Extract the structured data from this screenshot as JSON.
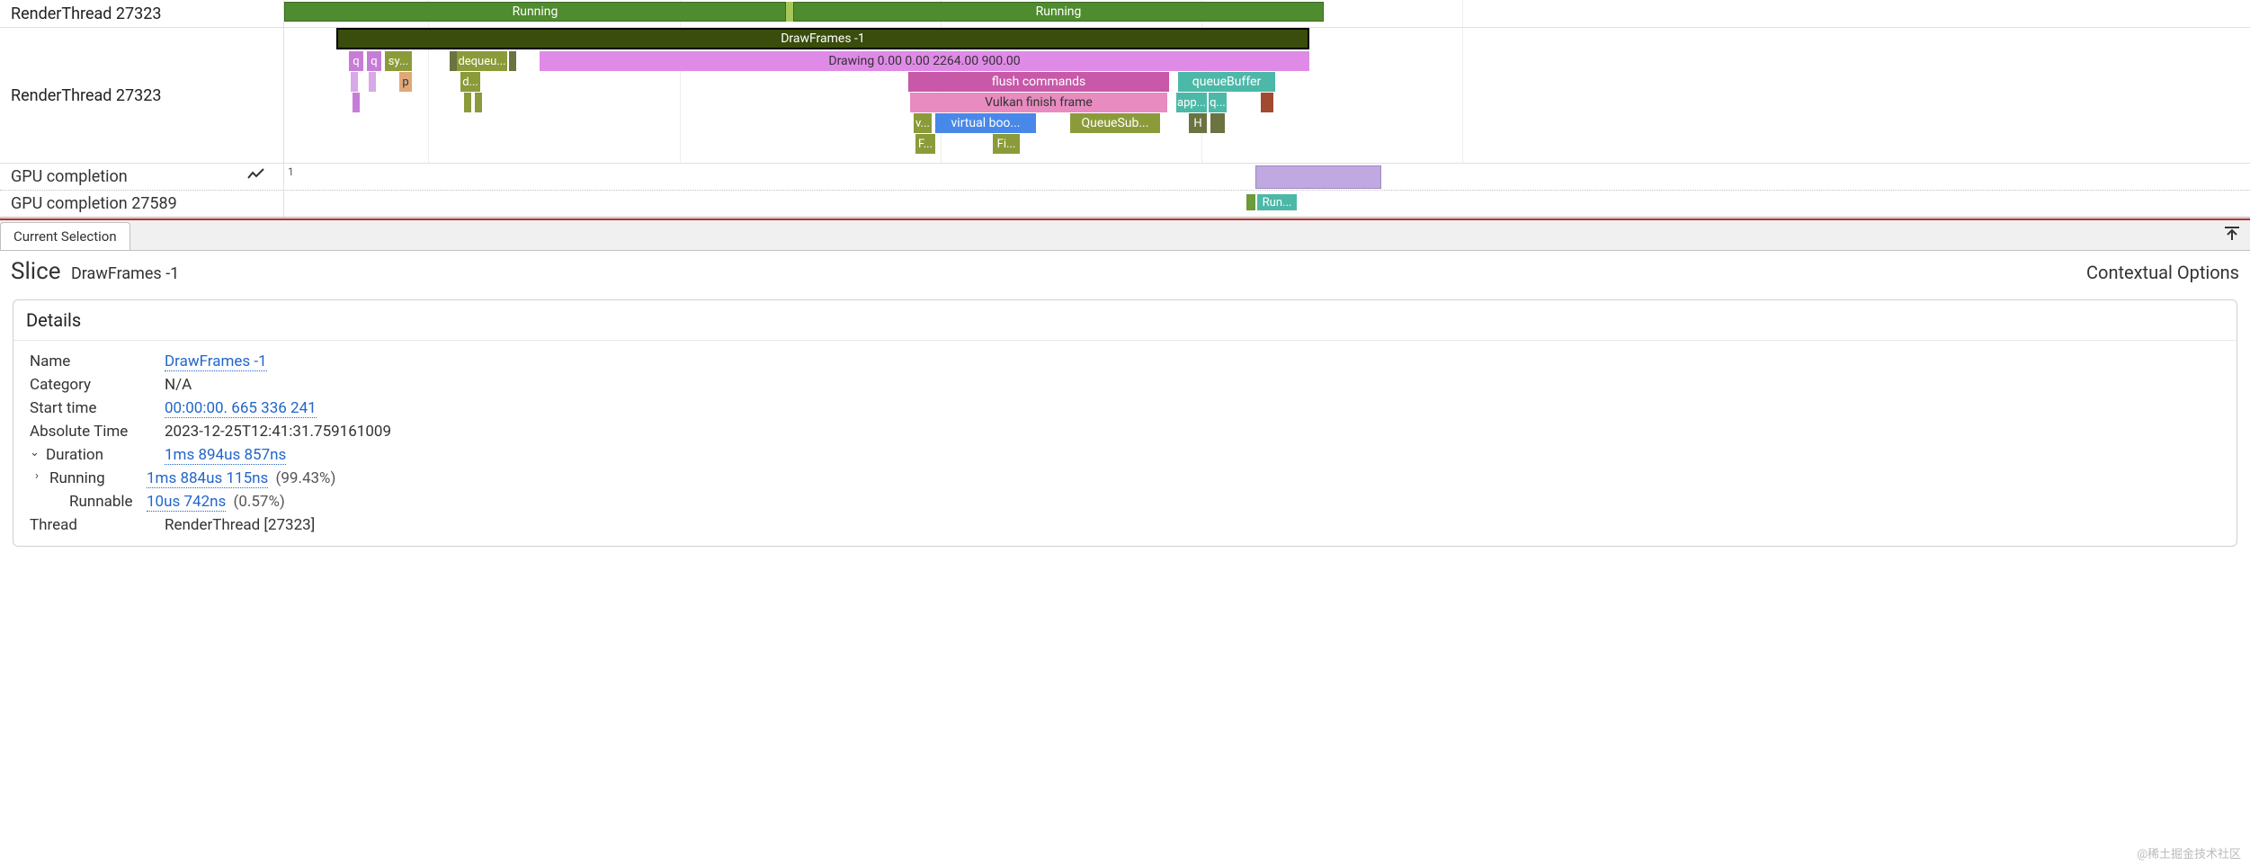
{
  "tracks": {
    "render_thread_row1": "RenderThread 27323",
    "render_thread_row2": "RenderThread 27323",
    "gpu_completion": "GPU completion",
    "gpu_completion_id": "GPU completion 27589",
    "gpu_count": "1"
  },
  "bars": {
    "running1": "Running",
    "running2": "Running",
    "drawframes": "DrawFrames -1",
    "q1": "q",
    "q2": "q",
    "sy": "sy...",
    "p": "p",
    "dequeue": "dequeu...",
    "d": "d...",
    "drawing": "Drawing  0.00  0.00 2264.00 900.00",
    "flush": "flush commands",
    "vulkan": "Vulkan finish frame",
    "v": "v...",
    "virtual_boo": "virtual boo...",
    "queue_sub": "QueueSub...",
    "f1": "F...",
    "fi": "Fi...",
    "h": "H",
    "queue_buffer": "queueBuffer",
    "app": "app...",
    "q3": "q...",
    "run_small": "Run..."
  },
  "tab": "Current Selection",
  "header": {
    "slice": "Slice",
    "name": "DrawFrames -1",
    "contextual": "Contextual Options"
  },
  "details": {
    "title": "Details",
    "rows": {
      "name_k": "Name",
      "name_v": "DrawFrames -1",
      "category_k": "Category",
      "category_v": "N/A",
      "start_k": "Start time",
      "start_v": "00:00:00. 665 336 241",
      "abs_k": "Absolute Time",
      "abs_v": "2023-12-25T12:41:31.759161009",
      "duration_k": "Duration",
      "duration_v": "1ms 894us 857ns",
      "running_k": "Running",
      "running_v": "1ms 884us 115ns",
      "running_pct": "(99.43%)",
      "runnable_k": "Runnable",
      "runnable_v": "10us 742ns",
      "runnable_pct": "(0.57%)",
      "thread_k": "Thread",
      "thread_v": "RenderThread [27323]"
    }
  },
  "watermark": "@稀土掘金技术社区"
}
